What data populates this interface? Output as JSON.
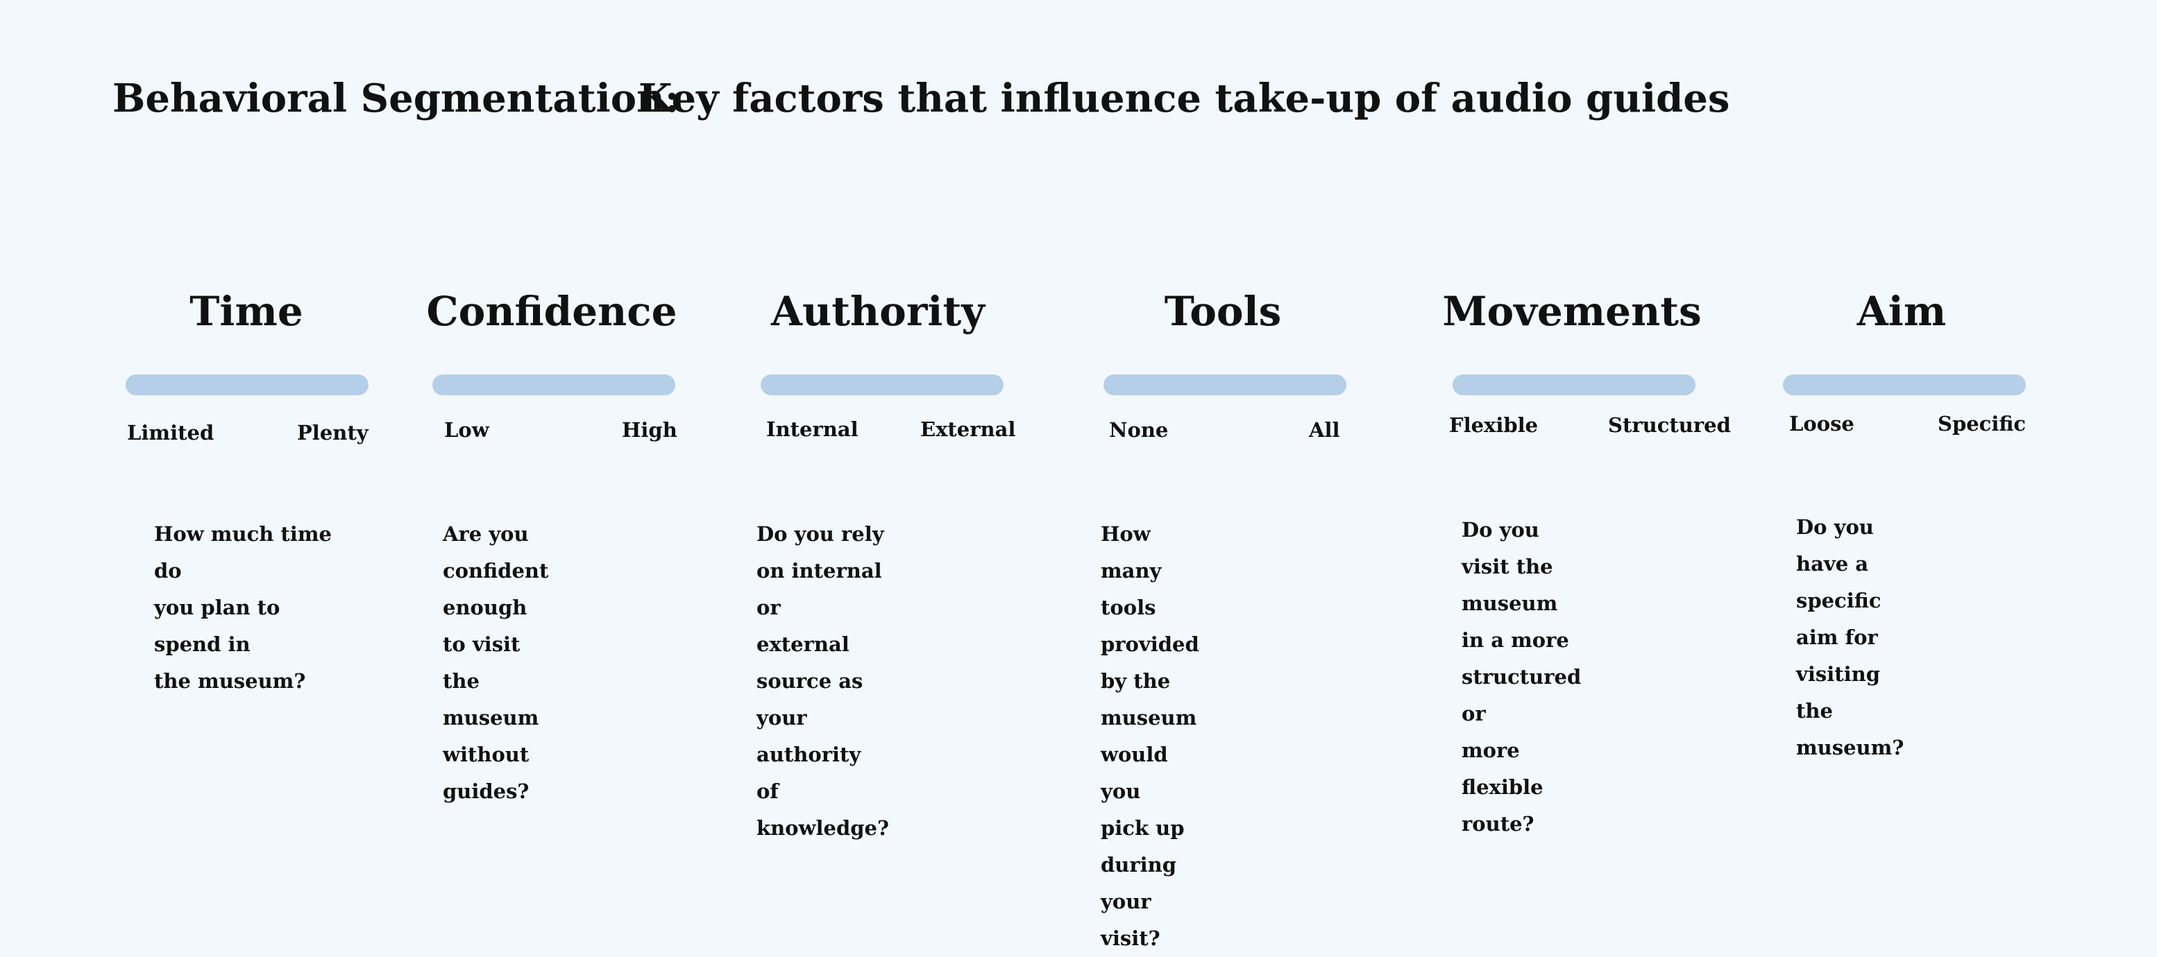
{
  "title": {
    "left": "Behavioral Segmentation:",
    "right": "Key factors that influence take-up of audio guides"
  },
  "colors": {
    "background": "#f3f8fc",
    "bar": "#b5cfe9",
    "text": "#111111"
  },
  "factors": [
    {
      "name": "Time",
      "low": "Limited",
      "high": "Plenty",
      "question": "How much time do\nyou plan to spend in\nthe museum?"
    },
    {
      "name": "Confidence",
      "low": "Low",
      "high": "High",
      "question": "Are you confident enough\nto visit the museum\nwithout guides?"
    },
    {
      "name": "Authority",
      "low": "Internal",
      "high": "External",
      "question": "Do you rely on internal or\nexternal source as your\nauthority of knowledge?"
    },
    {
      "name": "Tools",
      "low": "None",
      "high": "All",
      "question": "How many tools provided\nby the museum would you\npick up during your visit?"
    },
    {
      "name": "Movements",
      "low": "Flexible",
      "high": "Structured",
      "question": "Do you visit the museum\nin a more structured or\nmore flexible route?"
    },
    {
      "name": "Aim",
      "low": "Loose",
      "high": "Specific",
      "question": "Do you have a specific\naim for visiting the\n museum?"
    }
  ]
}
